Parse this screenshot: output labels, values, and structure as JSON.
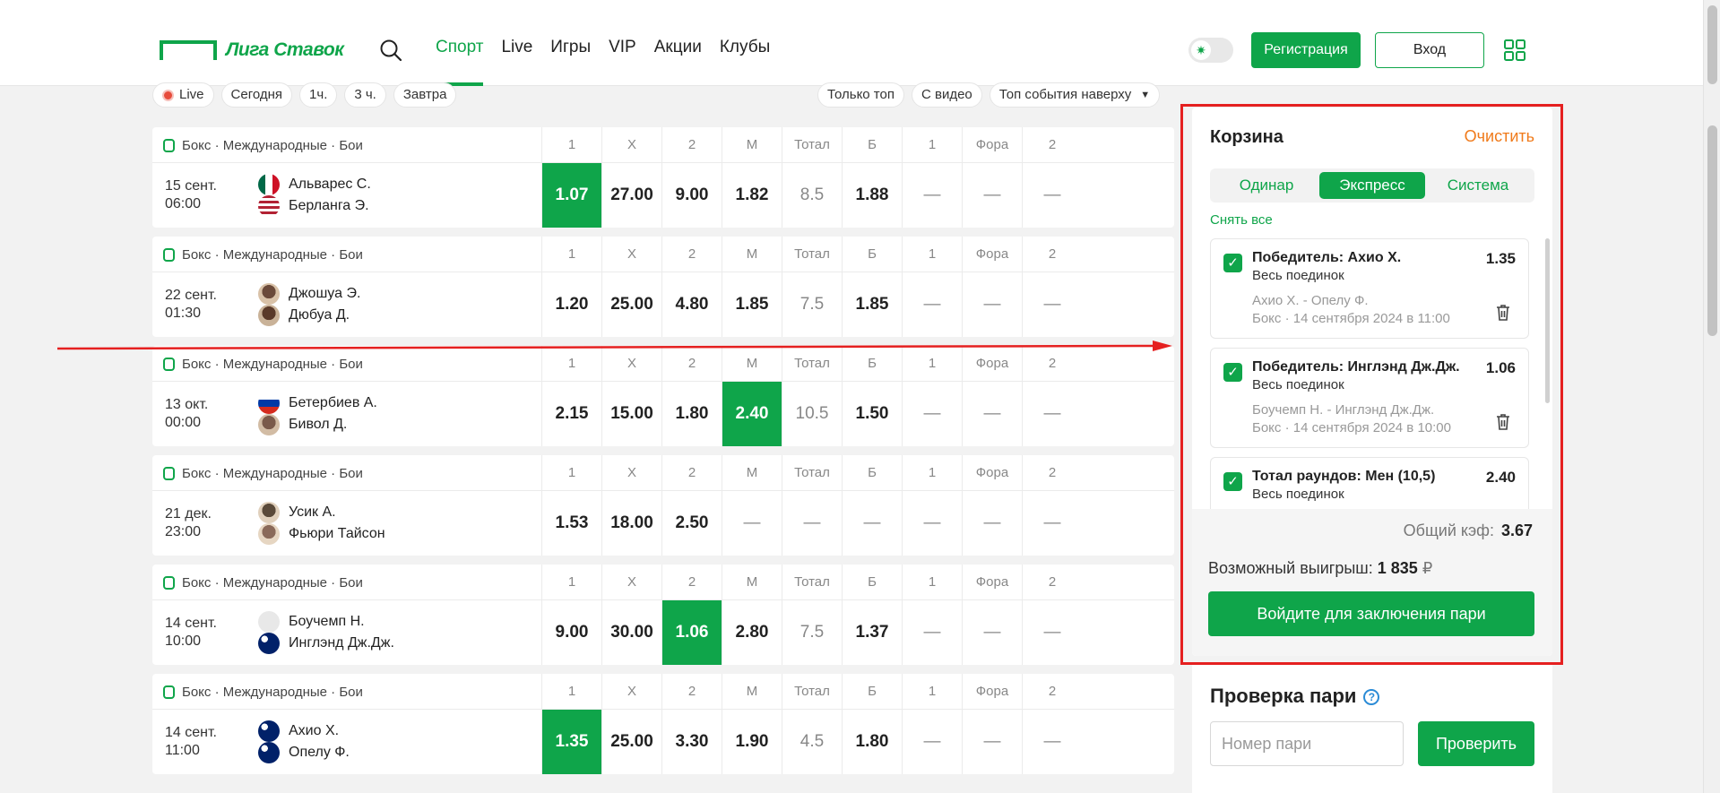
{
  "header": {
    "logo": "Лига Ставок",
    "nav": [
      "Спорт",
      "Live",
      "Игры",
      "VIP",
      "Акции",
      "Клубы"
    ],
    "active_nav": "Спорт",
    "register": "Регистрация",
    "login": "Вход"
  },
  "filters": {
    "left": [
      "Live",
      "Сегодня",
      "1ч.",
      "3 ч.",
      "Завтра"
    ],
    "right": [
      "Только топ",
      "С видео",
      "Топ события наверху"
    ]
  },
  "market_labels": [
    "1",
    "X",
    "2",
    "М",
    "Тотал",
    "Б",
    "1",
    "Фора",
    "2"
  ],
  "events": [
    {
      "league": "Бокс · Международные · Бои",
      "date": "15 сент.",
      "time": "06:00",
      "team1": "Альварес С.",
      "team2": "Берланга Э.",
      "odds": [
        "1.07",
        "27.00",
        "9.00",
        "1.82",
        "8.5",
        "1.88",
        "—",
        "—",
        "—"
      ],
      "selected": 0
    },
    {
      "league": "Бокс · Международные · Бои",
      "date": "22 сент.",
      "time": "01:30",
      "team1": "Джошуа Э.",
      "team2": "Дюбуа Д.",
      "odds": [
        "1.20",
        "25.00",
        "4.80",
        "1.85",
        "7.5",
        "1.85",
        "—",
        "—",
        "—"
      ],
      "selected": -1
    },
    {
      "league": "Бокс · Международные · Бои",
      "date": "13 окт.",
      "time": "00:00",
      "team1": "Бетербиев А.",
      "team2": "Бивол Д.",
      "odds": [
        "2.15",
        "15.00",
        "1.80",
        "2.40",
        "10.5",
        "1.50",
        "—",
        "—",
        "—"
      ],
      "selected": 3
    },
    {
      "league": "Бокс · Международные · Бои",
      "date": "21 дек.",
      "time": "23:00",
      "team1": "Усик А.",
      "team2": "Фьюри Тайсон",
      "odds": [
        "1.53",
        "18.00",
        "2.50",
        "—",
        "—",
        "—",
        "—",
        "—",
        "—"
      ],
      "selected": -1
    },
    {
      "league": "Бокс · Международные · Бои",
      "date": "14 сент.",
      "time": "10:00",
      "team1": "Боучемп Н.",
      "team2": "Инглэнд Дж.Дж.",
      "odds": [
        "9.00",
        "30.00",
        "1.06",
        "2.80",
        "7.5",
        "1.37",
        "—",
        "—",
        "—"
      ],
      "selected": 2
    },
    {
      "league": "Бокс · Международные · Бои",
      "date": "14 сент.",
      "time": "11:00",
      "team1": "Ахио Х.",
      "team2": "Опелу Ф.",
      "odds": [
        "1.35",
        "25.00",
        "3.30",
        "1.90",
        "4.5",
        "1.80",
        "—",
        "—",
        "—"
      ],
      "selected": 0
    }
  ],
  "coupon": {
    "title": "Корзина",
    "clear": "Очистить",
    "tabs": [
      "Одинар",
      "Экспресс",
      "Система"
    ],
    "active_tab": "Экспресс",
    "remove_all": "Снять все",
    "bets": [
      {
        "title": "Победитель: Ахио Х.",
        "odd": "1.35",
        "sub": "Весь поединок",
        "match": "Ахио Х. - Опелу Ф.",
        "sport": "Бокс · 14 сентября 2024 в 11:00"
      },
      {
        "title": "Победитель: Инглэнд Дж.Дж.",
        "odd": "1.06",
        "sub": "Весь поединок",
        "match": "Боучемп Н. - Инглэнд Дж.Дж.",
        "sport": "Бокс · 14 сентября 2024 в 10:00"
      },
      {
        "title": "Тотал раундов: Мен (10,5)",
        "odd": "2.40",
        "sub": "Весь поединок",
        "match": "",
        "sport": ""
      }
    ],
    "total_label": "Общий кэф:",
    "total_value": "3.67",
    "win_label": "Возможный выигрыш:",
    "win_value": "1 835",
    "currency": "₽",
    "login_btn": "Войдите для заключения пари"
  },
  "check": {
    "title": "Проверка пари",
    "placeholder": "Номер пари",
    "button": "Проверить"
  },
  "colors": {
    "brand": "#0fa54a",
    "accent": "#f07a1a",
    "highlight": "#e52020"
  }
}
